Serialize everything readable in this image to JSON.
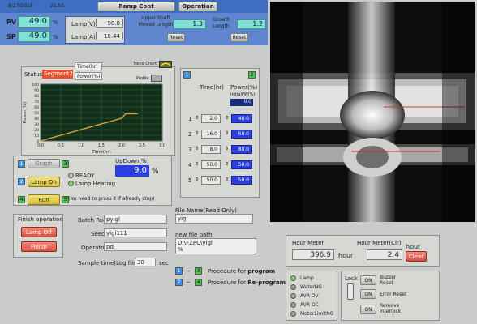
{
  "topbar": {
    "date": "8/27/2018",
    "time": "21:55",
    "ramp_cont_label": "Ramp Cont",
    "operation_label": "Operation"
  },
  "readouts": {
    "pv_label": "PV",
    "pv_value": "49.0",
    "pv_unit": "%",
    "sp_label": "SP",
    "sp_value": "49.0",
    "sp_unit": "%",
    "lamp_v_label": "Lamp(V)",
    "lamp_v_value": "98.8",
    "lamp_a_label": "Lamp(A)",
    "lamp_a_value": "18.44",
    "upper_shaft_label": "Upper Shaft Moved Length",
    "upper_shaft_value": "1.3",
    "growth_length_label": "Growth Length",
    "growth_length_value": "1.2",
    "reset_label": "Reset"
  },
  "status": {
    "status_label": "Status",
    "status_value": "Segment2",
    "time_label": "Time(hr)",
    "power_label": "Power(%)",
    "trend_chart_label": "Trend Chart",
    "profile_label": "Profile"
  },
  "chart_data": {
    "type": "line",
    "xlabel": "Time(hr)",
    "ylabel": "Power(%)",
    "xlim": [
      0,
      3
    ],
    "ylim": [
      0,
      100
    ],
    "x_ticks": [
      "0.0",
      "0.5",
      "1.0",
      "1.5",
      "2.0",
      "2.5",
      "3.0"
    ],
    "y_ticks": [
      "0",
      "10",
      "20",
      "30",
      "40",
      "50",
      "60",
      "70",
      "80",
      "90",
      "100"
    ],
    "grid": true,
    "series": [
      {
        "color": "#d8a640",
        "x": [
          0.0,
          2.0,
          2.1,
          2.4
        ],
        "y": [
          0,
          40,
          48,
          48
        ]
      }
    ]
  },
  "profile_table": {
    "col1": "Time(hr)",
    "col2": "Power(%)",
    "initial_label": "InitialPW(%)",
    "initial_value": "0.0",
    "badge1": "1",
    "badge2": "2",
    "rows": [
      {
        "num": "1",
        "time": "2.0",
        "power": "40.0"
      },
      {
        "num": "2",
        "time": "16.0",
        "power": "60.0"
      },
      {
        "num": "3",
        "time": "8.0",
        "power": "80.0"
      },
      {
        "num": "4",
        "time": "50.0",
        "power": "50.0"
      },
      {
        "num": "5",
        "time": "50.0",
        "power": "50.0"
      }
    ]
  },
  "controls": {
    "graph_label": "Graph",
    "lamp_on_label": "Lamp On",
    "run_label": "Run",
    "updown_label": "UpDown(%)",
    "updown_value": "9.0",
    "updown_unit": "%",
    "ready_label": "READY",
    "lamp_heating_label": "Lamp Heating",
    "note": "(No need to press it  if already stop)",
    "badges": [
      "1",
      "2",
      "3",
      "4",
      "5"
    ]
  },
  "finish": {
    "title": "Finish operation",
    "lamp_off_label": "Lamp Off",
    "finish_label": "Finish"
  },
  "batch": {
    "batch_rod_label": "Batch Rod",
    "batch_rod_value": "pyigl",
    "seed_label": "Seed",
    "seed_value": "yigl111",
    "operator_label": "Operator",
    "operator_value": "pd",
    "sample_time_label": "Sample time(Log file)",
    "sample_time_value": "30",
    "sample_time_unit": "sec"
  },
  "file": {
    "name_label": "File Name(Read Only)",
    "name_value": "yigl",
    "new_path_label": "new file path",
    "path_value": "D:\\FZPC\\yigl",
    "path_suffix": "%"
  },
  "procedures": {
    "program_text": "Procedure for",
    "program_bold": "program",
    "reprogram_text": "Procedure for",
    "reprogram_bold": "Re-program",
    "badges": [
      "1",
      "3",
      "2",
      "4"
    ]
  },
  "hour_meter": {
    "hm_label": "Hour Meter",
    "hm_value": "396.9",
    "hm_unit": "hour",
    "hmc_label": "Hour Meter(Clr)",
    "hmc_value": "2.4",
    "hmc_unit": "hour",
    "clear_label": "Clear"
  },
  "alarms": {
    "items": [
      "Lamp",
      "WaterNG",
      "AVR OV",
      "AVR OC",
      "MotorLimitNG"
    ],
    "led_colors": [
      "#7ed957",
      "#9aa29a",
      "#9aa29a",
      "#9aa29a",
      "#9aa29a"
    ],
    "lock_label": "Lock",
    "on_label": "ON",
    "buzzer_reset_label": "Buzzer Reset",
    "error_reset_label": "Error Reset",
    "remove_interlock_label": "Remove Interlock"
  }
}
